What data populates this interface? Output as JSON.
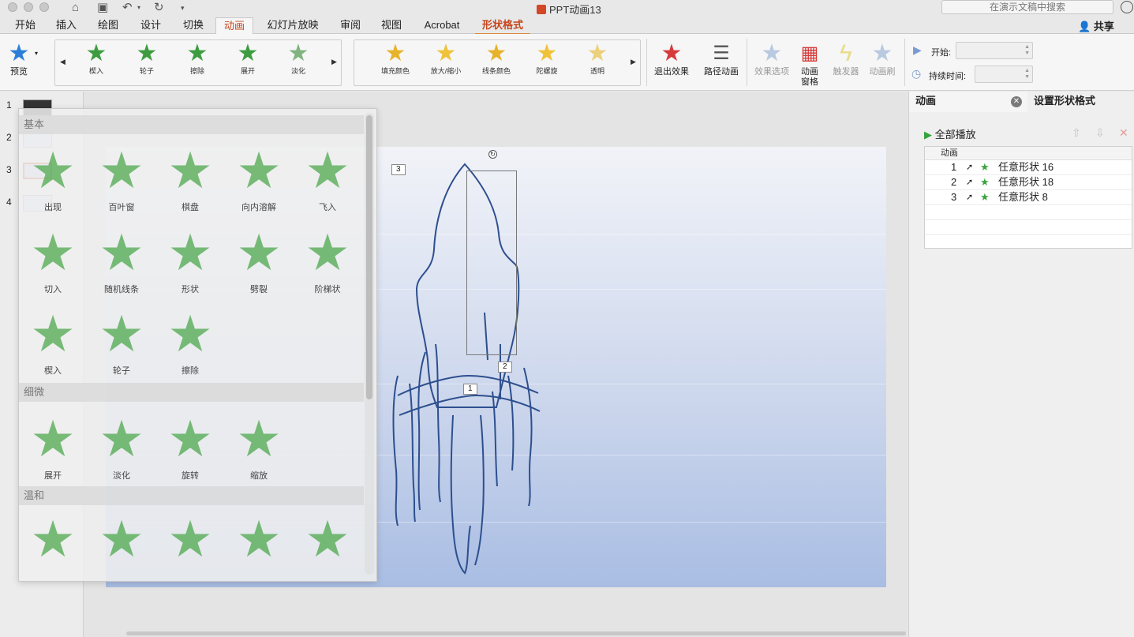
{
  "window": {
    "title": "PPT动画13",
    "search_placeholder": "在演示文稿中搜索"
  },
  "tabs": [
    "开始",
    "插入",
    "绘图",
    "设计",
    "切换",
    "动画",
    "幻灯片放映",
    "审阅",
    "视图",
    "Acrobat",
    "形状格式"
  ],
  "share_label": "共享",
  "ribbon": {
    "preview_label": "预览",
    "gallery1": [
      "楔入",
      "轮子",
      "擦除",
      "展开",
      "淡化"
    ],
    "gallery2": [
      "填充颜色",
      "放大/缩小",
      "线条颜色",
      "陀螺旋",
      "透明"
    ],
    "exit_effects": "退出效果",
    "path_animation": "路径动画",
    "effect_options": "效果选项",
    "animation_pane": "动画\n窗格",
    "trigger": "触发器",
    "painter": "动画刷",
    "start_label": "开始:",
    "duration_label": "持续时间:"
  },
  "thumbnails": [
    "1",
    "2",
    "3",
    "4"
  ],
  "dropdown": {
    "sections": [
      "基本",
      "细微",
      "温和"
    ],
    "basic": [
      "出现",
      "百叶窗",
      "棋盘",
      "向内溶解",
      "飞入",
      "切入",
      "随机线条",
      "形状",
      "劈裂",
      "阶梯状",
      "楔入",
      "轮子",
      "擦除"
    ],
    "subtle": [
      "展开",
      "淡化",
      "旋转",
      "缩放"
    ]
  },
  "slide_tags": [
    "3",
    "2",
    "1"
  ],
  "pane": {
    "tab_animation": "动画",
    "tab_format": "设置形状格式",
    "play_all": "全部播放",
    "list_header": "动画",
    "items": [
      {
        "num": "1",
        "name": "任意形状 16"
      },
      {
        "num": "2",
        "name": "任意形状 18"
      },
      {
        "num": "3",
        "name": "任意形状 8"
      }
    ]
  }
}
